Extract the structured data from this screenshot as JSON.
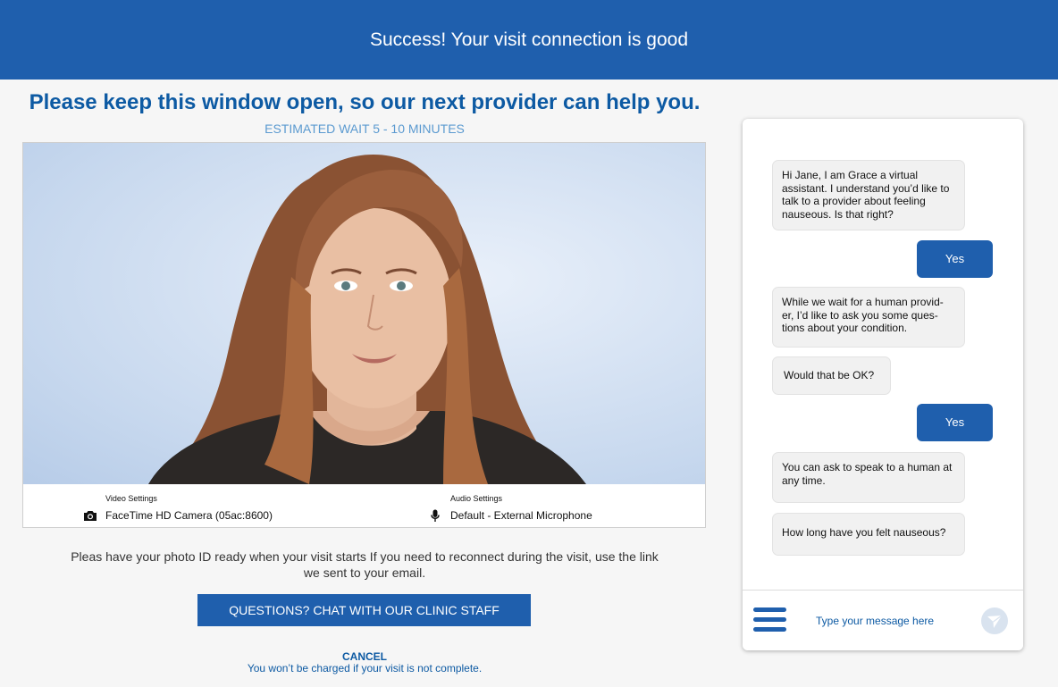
{
  "banner": {
    "text": "Success! Your visit connection is good"
  },
  "headline": "Please keep this window open, so our next provider can help you.",
  "wait_estimate": "ESTIMATED WAIT 5 - 10 MINUTES",
  "video": {
    "video_settings_label": "Video Settings",
    "camera": "FaceTime HD Camera (05ac:8600)",
    "camera_icon": "camera-icon",
    "audio_settings_label": "Audio Settings",
    "microphone": "Default - External Microphone",
    "microphone_icon": "microphone-icon"
  },
  "note": "Pleas have your photo ID ready when your visit starts  If you need to reconnect during the visit, use the link we sent to your email.",
  "chat_staff_button": "QUESTIONS? CHAT WITH OUR CLINIC STAFF",
  "cancel": {
    "label": "CANCEL",
    "note": "You won’t be charged if your visit is not complete."
  },
  "chat": {
    "messages": [
      {
        "from": "bot",
        "text": "Hi Jane, I am Grace a virtual assistant.  I understand you’d like to talk to a provider about feeling nauseous.  Is that right?"
      },
      {
        "from": "user",
        "text": "Yes"
      },
      {
        "from": "bot",
        "text": "While we wait for a human provid-er, I’d like to ask you some ques-tions about your condition."
      },
      {
        "from": "bot",
        "text": "Would that be OK?"
      },
      {
        "from": "user",
        "text": "Yes"
      },
      {
        "from": "bot",
        "text": "You can ask to speak to a human at any time."
      },
      {
        "from": "bot",
        "text": "How long have you felt nauseous?"
      }
    ],
    "input_placeholder": "Type your message here",
    "menu_icon": "menu-icon",
    "send_icon": "send-icon"
  },
  "colors": {
    "brand_blue": "#1f5fad",
    "heading_blue": "#0d5aa3",
    "wait_blue": "#5b9ad0",
    "background": "#f6f6f6"
  }
}
